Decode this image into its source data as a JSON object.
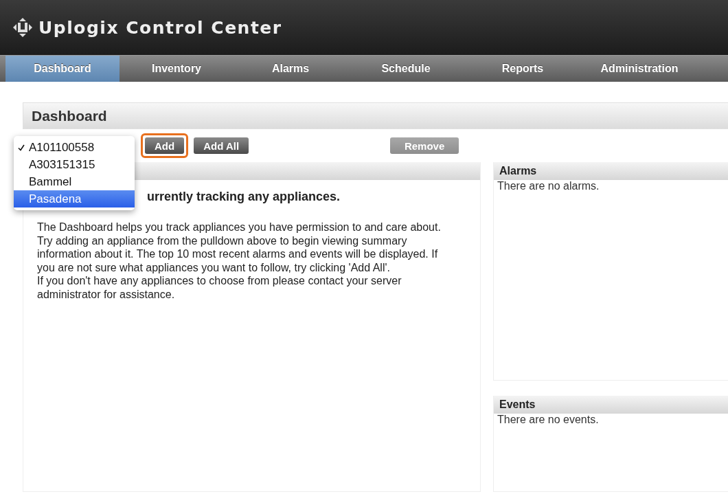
{
  "app": {
    "title": "Uplogix Control Center"
  },
  "nav": [
    {
      "label": "Dashboard",
      "selected": true
    },
    {
      "label": "Inventory",
      "selected": false
    },
    {
      "label": "Alarms",
      "selected": false
    },
    {
      "label": "Schedule",
      "selected": false
    },
    {
      "label": "Reports",
      "selected": false
    },
    {
      "label": "Administration",
      "selected": false
    }
  ],
  "page_title": "Dashboard",
  "appliance_menu": [
    {
      "label": "A101100558",
      "checked": true,
      "highlighted": false
    },
    {
      "label": "A303151315",
      "checked": false,
      "highlighted": false
    },
    {
      "label": "Bammel",
      "checked": false,
      "highlighted": false
    },
    {
      "label": "Pasadena",
      "checked": false,
      "highlighted": true
    }
  ],
  "buttons": [
    {
      "label": "Add",
      "disabled": false,
      "outlined": true
    },
    {
      "label": "Add All",
      "disabled": false,
      "outlined": false
    }
  ],
  "remove_button": {
    "label": "Remove",
    "disabled": true
  },
  "main_panel": {
    "heading": "urrently tracking any appliances.",
    "paragraphs": [
      "The Dashboard helps you track appliances you have permission to and care about. Try adding an appliance from the pulldown above to begin viewing summary information about it. The top 10 most recent alarms and events will be displayed. If you are not sure what appliances you want to follow, try clicking 'Add All'.",
      "If you don't have any appliances to choose from please contact your server administrator for assistance."
    ]
  },
  "side_panels": [
    {
      "title": "Alarms",
      "message": "There are no alarms."
    },
    {
      "title": "Events",
      "message": "There are no events."
    }
  ]
}
